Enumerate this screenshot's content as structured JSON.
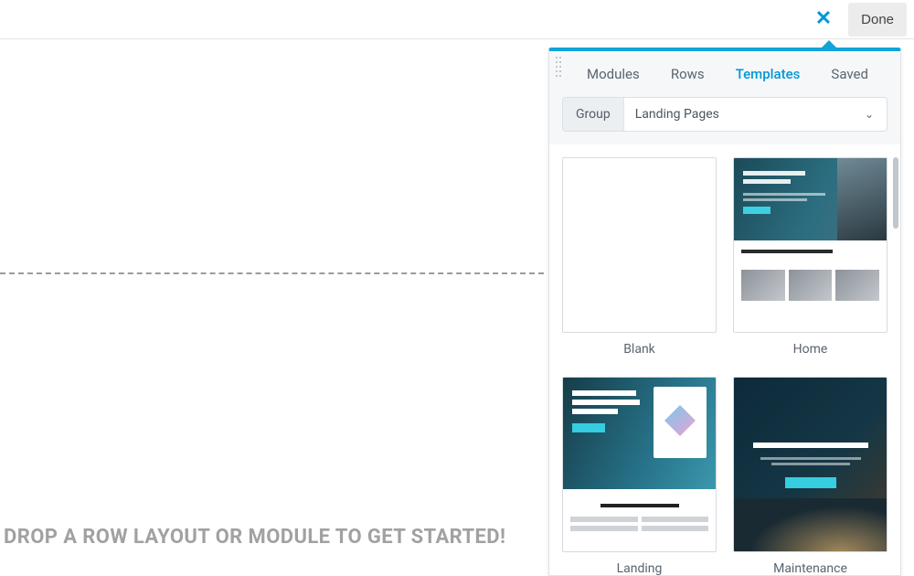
{
  "toolbar": {
    "done_label": "Done"
  },
  "drop_hint": "DROP A ROW LAYOUT OR MODULE TO GET STARTED!",
  "panel": {
    "tabs": {
      "modules": "Modules",
      "rows": "Rows",
      "templates": "Templates",
      "saved": "Saved"
    },
    "active_tab": "templates",
    "group_label": "Group",
    "group_value": "Landing Pages",
    "templates": [
      {
        "name": "Blank"
      },
      {
        "name": "Home"
      },
      {
        "name": "Landing"
      },
      {
        "name": "Maintenance"
      }
    ]
  }
}
